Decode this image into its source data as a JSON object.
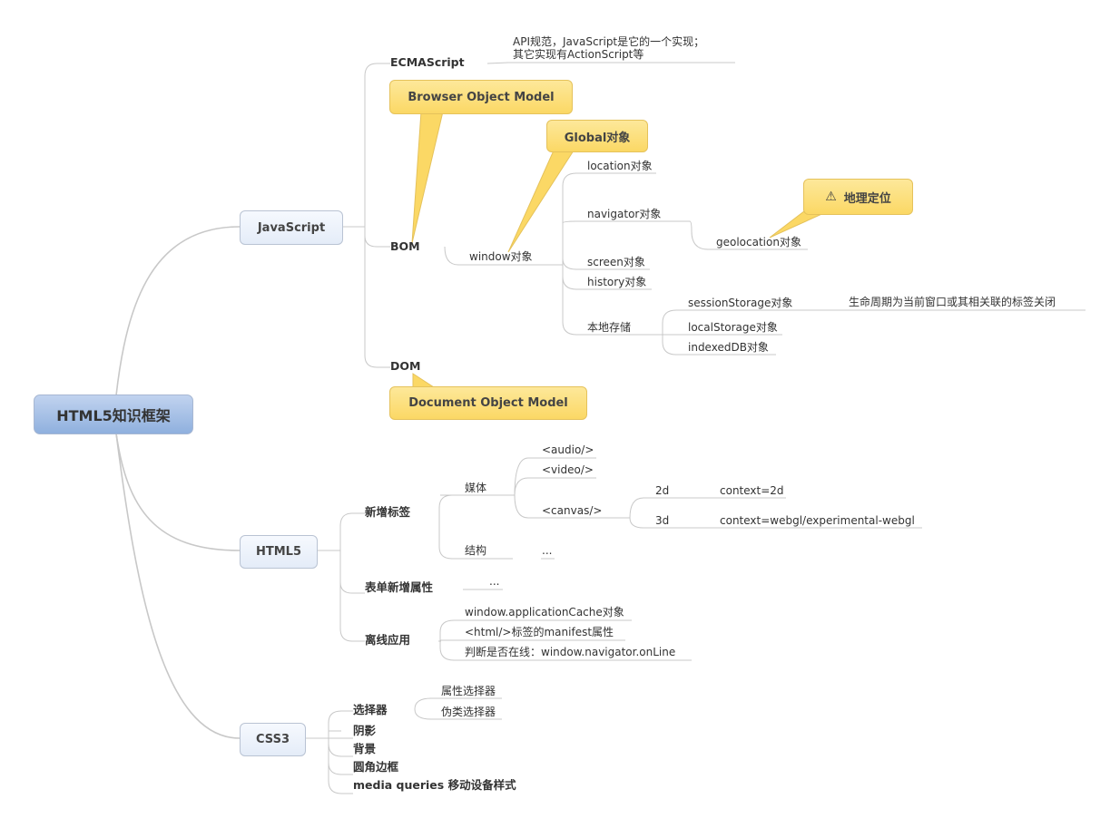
{
  "root": {
    "label": "HTML5知识框架"
  },
  "branches": {
    "javascript": {
      "label": "JavaScript",
      "children": {
        "ecmascript": {
          "label": "ECMAScript",
          "note_line1": "API规范，JavaScript是它的一个实现；",
          "note_line2": "其它实现有ActionScript等"
        },
        "bom": {
          "label": "BOM",
          "callout": "Browser Object Model",
          "window": {
            "label": "window对象",
            "callout": "Global对象",
            "items": {
              "location": "location对象",
              "navigator": "navigator对象",
              "geolocation": "geolocation对象",
              "geolocation_callout": "地理定位",
              "screen": "screen对象",
              "history": "history对象",
              "storage": "本地存储",
              "session": "sessionStorage对象",
              "session_note": "生命周期为当前窗口或其相关联的标签关闭",
              "local": "localStorage对象",
              "indexeddb": "indexedDB对象"
            }
          }
        },
        "dom": {
          "label": "DOM",
          "callout": "Document Object Model"
        }
      }
    },
    "html5": {
      "label": "HTML5",
      "new_tags": {
        "label": "新增标签",
        "media": {
          "label": "媒体",
          "audio": "<audio/>",
          "video": "<video/>",
          "canvas": "<canvas/>",
          "c2d": "2d",
          "c2d_ctx": "context=2d",
          "c3d": "3d",
          "c3d_ctx": "context=webgl/experimental-webgl"
        },
        "structure": {
          "label": "结构",
          "more": "..."
        }
      },
      "form": {
        "label": "表单新增属性",
        "more": "..."
      },
      "offline": {
        "label": "离线应用",
        "items": [
          "window.applicationCache对象",
          "<html/>标签的manifest属性",
          "判断是否在线：window.navigator.onLine"
        ]
      }
    },
    "css3": {
      "label": "CSS3",
      "selector": {
        "label": "选择器",
        "attr": "属性选择器",
        "pseudo": "伪类选择器"
      },
      "items": [
        "阴影",
        "背景",
        "圆角边框",
        "media queries 移动设备样式"
      ]
    }
  },
  "icons": {
    "warning": "⚠"
  },
  "colors": {
    "callout_fill": "#fbd865",
    "root_fill": "#8fb0de",
    "topic_fill": "#e4ecf8",
    "line": "#c8c8c8"
  }
}
